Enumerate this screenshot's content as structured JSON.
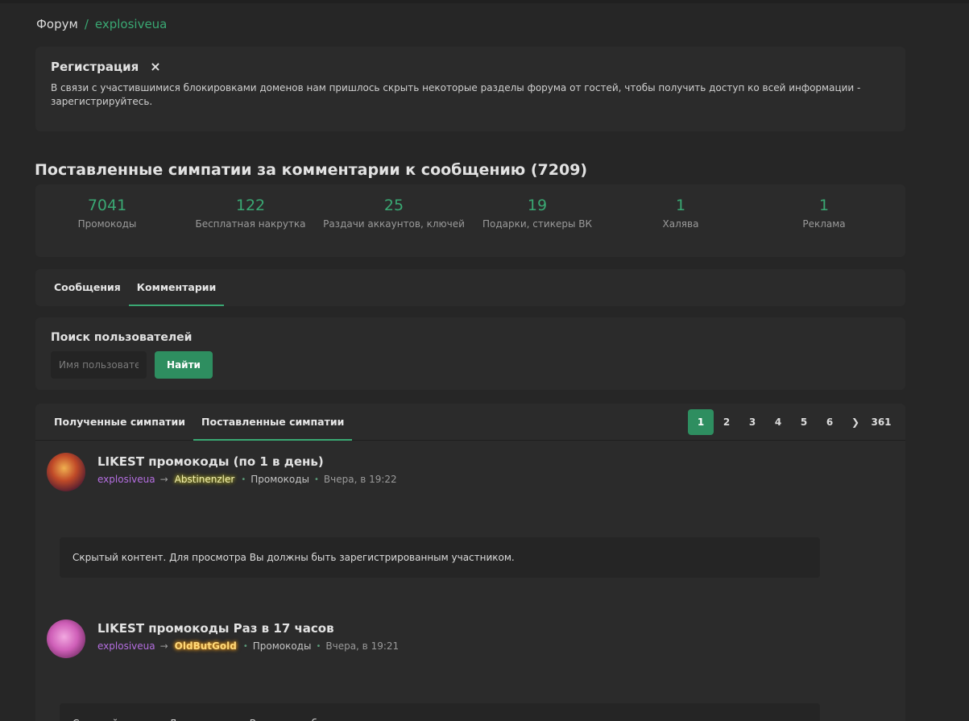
{
  "breadcrumb": {
    "root": "Форум",
    "separator": "/",
    "current": "explosiveua"
  },
  "notice": {
    "title": "Регистрация",
    "close_icon": "×",
    "text": "В связи с участившимися блокировками доменов нам пришлось скрыть некоторые разделы форума от гостей, чтобы получить доступ ко всей информации - зарегистрируйтесь."
  },
  "page_title": "Поставленные симпатии за комментарии к сообщению (7209)",
  "stats": [
    {
      "value": "7041",
      "label": "Промокоды"
    },
    {
      "value": "122",
      "label": "Бесплатная накрутка"
    },
    {
      "value": "25",
      "label": "Раздачи аккаунтов, ключей"
    },
    {
      "value": "19",
      "label": "Подарки, стикеры ВК"
    },
    {
      "value": "1",
      "label": "Халява"
    },
    {
      "value": "1",
      "label": "Реклама"
    }
  ],
  "tabs_top": [
    {
      "label": "Сообщения",
      "active": false
    },
    {
      "label": "Комментарии",
      "active": true
    }
  ],
  "search": {
    "title": "Поиск пользователей",
    "placeholder": "Имя пользователя",
    "button": "Найти"
  },
  "tabs_list": [
    {
      "label": "Полученные симпатии",
      "active": false
    },
    {
      "label": "Поставленные симпатии",
      "active": true
    }
  ],
  "pager": {
    "pages": [
      "1",
      "2",
      "3",
      "4",
      "5",
      "6"
    ],
    "next_icon": "❯",
    "last": "361",
    "current": "1"
  },
  "items": [
    {
      "title": "LIKEST промокоды (по 1 в день)",
      "user": "explosiveua",
      "arrow": "→",
      "target": "Abstinenzler",
      "dot": "•",
      "category": "Промокоды",
      "date": "Вчера, в 19:22",
      "hidden_text": "Скрытый контент. Для просмотра Вы должны быть зарегистрированным участником."
    },
    {
      "title": "LIKEST промокоды Раз в 17 часов",
      "user": "explosiveua",
      "arrow": "→",
      "target": "OldButGold",
      "dot": "•",
      "category": "Промокоды",
      "date": "Вчера, в 19:21",
      "hidden_text": "Скрытый контент. Для просмотра Вы должны быть зарегистрированным участником."
    }
  ],
  "colors": {
    "accent": "#3aa873",
    "button": "#2e8e60",
    "user": "#b46ee0",
    "background": "#262626",
    "panel": "#2b2b2b"
  }
}
